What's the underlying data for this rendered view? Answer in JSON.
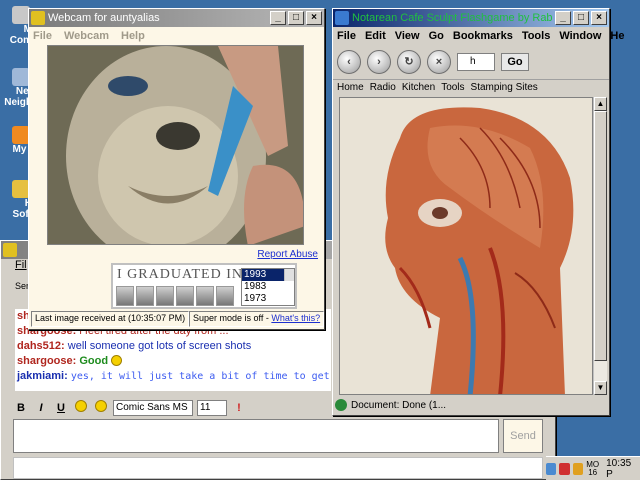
{
  "desktop": {
    "icons": [
      {
        "label": "M",
        "label2": "Com",
        "icon": "my-computer-icon"
      },
      {
        "label": "Net",
        "label2": "Neigh",
        "icon": "network-neighborhood-icon"
      },
      {
        "label": "My I",
        "icon": "my-documents-icon"
      },
      {
        "label": "H",
        "label2": "Soft",
        "icon": "software-icon"
      }
    ]
  },
  "webcam_window": {
    "title": "Webcam for auntyalias",
    "menu": [
      "File",
      "Webcam",
      "Help"
    ],
    "report_abuse": "Report Abuse",
    "ad": {
      "headline": "I GRADUATED IN:",
      "years": [
        "1993",
        "1983",
        "1973"
      ],
      "selected_year": "1993"
    },
    "status_last_image": "Last image received at (10:35:07 PM)",
    "status_super_mode": "Super mode is off - ",
    "status_whats_this": "What's this?"
  },
  "browser_window": {
    "title": "Notarean Cafe Sculpt Flashgame by Rabia - Mo",
    "menu": [
      "File",
      "Edit",
      "View",
      "Go",
      "Bookmarks",
      "Tools",
      "Window",
      "He"
    ],
    "url_text": "h",
    "go_label": "Go",
    "bookmarks": [
      "Home",
      "Radio",
      "Kitchen",
      "Tools",
      "Stamping Sites"
    ],
    "status": "Document: Done (1..."
  },
  "chat_window": {
    "menu_label": "Fil",
    "sidebar_label": "Sen",
    "messages": [
      {
        "user": "sh",
        "text": ""
      },
      {
        "user": "shargoose:",
        "text": "i feel tired after the day from ..."
      },
      {
        "user": "dahs512:",
        "text": "well someone got lots of screen shots"
      },
      {
        "user": "shargoose:",
        "text": "Good"
      },
      {
        "user": "jakmiami:",
        "text": "yes, it will just take a bit of time to get them up"
      }
    ],
    "toolbar": {
      "bold": "B",
      "italic": "I",
      "underline": "U",
      "font": "Comic Sans MS",
      "size": "11"
    },
    "send_label": "Send"
  },
  "tray": {
    "day": "MO",
    "date": "16",
    "time": "10:35 P"
  },
  "colors": {
    "title_active": "#0a246a",
    "link": "#1c2fd0",
    "user_shargoose": "#b0261e",
    "user_dahs": "#b0261e",
    "user_jak": "#1a2fb0",
    "jak_text": "#3d5cf0"
  }
}
